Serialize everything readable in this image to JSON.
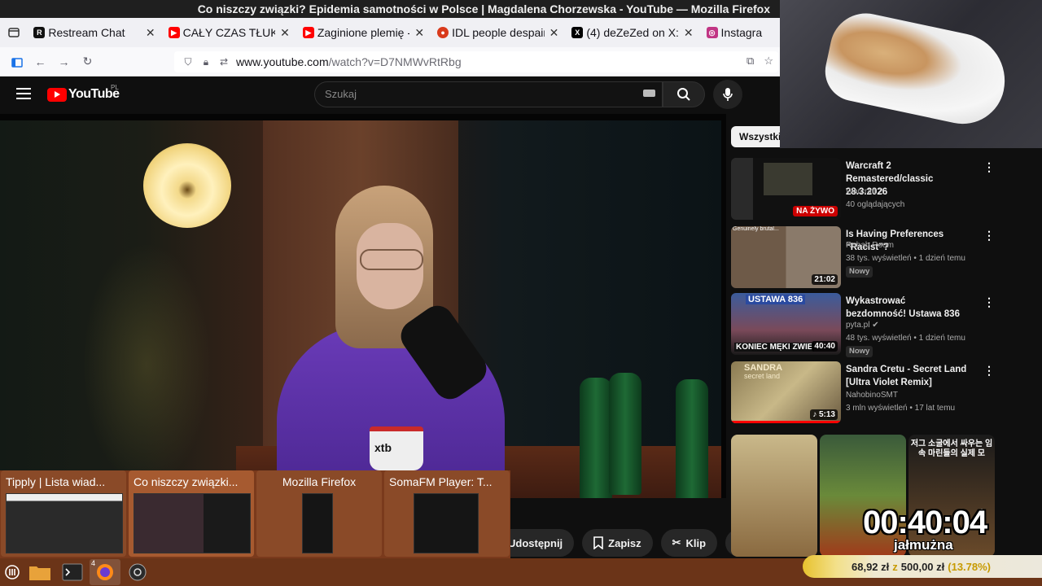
{
  "window": {
    "title": "Co niszczy związki? Epidemia samotności w Polsce | Magdalena Chorzewska - YouTube — Mozilla Firefox"
  },
  "tabs": [
    {
      "label": "Restream Chat",
      "color": "#111111",
      "glyph": "R"
    },
    {
      "label": "CAŁY CZAS TŁUKŁO",
      "color": "#ff0000",
      "glyph": "▶"
    },
    {
      "label": "Zaginione plemię -",
      "color": "#ff0000",
      "glyph": "▶"
    },
    {
      "label": "IDL people despair",
      "color": "#d93a1c",
      "glyph": "●"
    },
    {
      "label": "(4) deZeZed on X: \"",
      "color": "#000000",
      "glyph": "X"
    },
    {
      "label": "Instagra",
      "color": "#c13584",
      "glyph": "◎"
    }
  ],
  "url": {
    "host": "www.youtube.com",
    "path": "/watch?v=D7NMWvRtRbg"
  },
  "youtube": {
    "logo_text": "YouTube",
    "region": "PL",
    "search_placeholder": "Szukaj"
  },
  "video": {
    "mug_brand": "xtb"
  },
  "actions": {
    "share": "Udostępnij",
    "save": "Zapisz",
    "clip": "Klip"
  },
  "sidebar": {
    "chip_all": "Wszystkie",
    "recommendations": [
      {
        "title": "Warcraft 2 Remastered/classic 28.3.2026",
        "channel": "Warcraft 2",
        "meta": "40 oglądających",
        "live": "NA ŻYWO",
        "new": "",
        "duration": "",
        "verified": false
      },
      {
        "title": "Is Having Preferences “Racist”?",
        "channel": "Rehab Room",
        "meta": "38 tys. wyświetleń • 1 dzień temu",
        "live": "",
        "new": "Nowy",
        "duration": "21:02",
        "thumb_caption": "Genuinely brutal...",
        "verified": false
      },
      {
        "title": "Wykastrować bezdomność! Ustawa 836",
        "channel": "pyta.pl",
        "meta": "48 tys. wyświetleń • 1 dzień temu",
        "live": "",
        "new": "Nowy",
        "duration": "40:40",
        "thumb_caption": "USTAWA 836",
        "thumb_caption2": "KONIEC MĘKI ZWIE",
        "verified": true
      },
      {
        "title": "Sandra Cretu - Secret Land [Ultra Violet Remix]",
        "channel": "NahobinoSMT",
        "meta": "3 mln wyświetleń • 17 lat temu",
        "live": "",
        "new": "",
        "duration": "♪ 5:13",
        "thumb_caption": "SANDRA",
        "thumb_caption2": "secret land",
        "verified": false
      }
    ],
    "short_caption": "저그 소굴에서 싸우는 임 속 마린들의 실제 모"
  },
  "timer": {
    "value": "00:40:04",
    "label": "jałmużna"
  },
  "donation": {
    "current": "68,92 zł",
    "separator": "z",
    "goal": "500,00 zł",
    "percent": "(13.78%)"
  },
  "previews": [
    {
      "title": "Tipply | Lista wiad..."
    },
    {
      "title": "Co niszczy związki..."
    },
    {
      "title": "Mozilla Firefox"
    },
    {
      "title": "SomaFM Player: T..."
    }
  ],
  "taskbar": {
    "firefox_badge": "4"
  }
}
